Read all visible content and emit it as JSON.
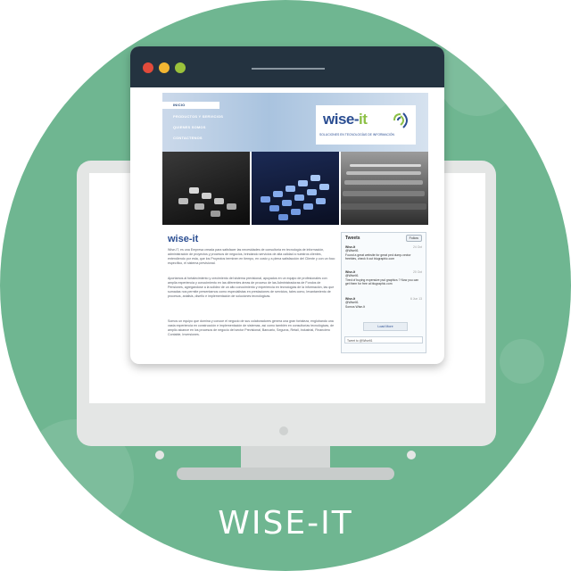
{
  "title": "WISE-IT",
  "browser": {
    "window_controls": [
      "close",
      "minimize",
      "maximize"
    ]
  },
  "site": {
    "nav": [
      "INICIO",
      "PRODUCTOS Y SERVICIOS",
      "QUIENES SOMOS",
      "CONTACTENOS"
    ],
    "logo_main": "wise-",
    "logo_accent": "it",
    "logo_tagline": "SOLUCIONES EN TECNOLOGÍAS DE INFORMACIÓN",
    "content_logo": "wise-it",
    "paragraphs": [
      "Wise-IT, es una Empresa creada para satisfacer las necesidades de consultoría en tecnología de información, administración de proyectos y procesos de negocios, brindando servicios de alta calidad a nuestros clientes, entendiendo por esta, que los Proyectos terminen en tiempo, en costo y a plena satisfacción del Cliente y con un foco específico, el sistema previsional.",
      "Aportamos al fortalecimiento y crecimiento del sistema previsional, apoyados en un equipo de profesionales con amplia experiencia y conocimiento en las diferentes áreas de proceso de las Administradoras de Fondos de Pensiones, agregándose a la solidez de un alto conocimiento y experiencia en tecnologías de la información, las que sumadas nos permite presentarnos como especialistas en prestaciones de servicios, tales como, levantamiento de procesos, análisis, diseño e implementación de soluciones tecnológicas.",
      "Somos un equipo que domina y conoce el negocio de sus colaboradores genera una gran fortaleza, englobando una vasta experiencia en construcción e implementación de sistemas, así como también en consultorías tecnológicas, de amplio alcance en los procesos de negocio del sector Previsional, Bancario, Seguros, Retail, Industrial, Financiero Contable, Inversiones."
    ],
    "tweets": {
      "header": "Tweets",
      "follow_label": "Follow",
      "items": [
        {
          "name": "Wise-It",
          "handle": "@WiseIt1",
          "date": "24 Oct",
          "text": "Found a great website for great ped dump-vector freebies, check it out blugraphic.com"
        },
        {
          "name": "Wise-It",
          "handle": "@WiseIt1",
          "date": "20 Oct",
          "text": "Tired of buying expensive psd graphics ? Now you can get them for free at blugraphic.com"
        },
        {
          "name": "Wise-It",
          "handle": "@WiseIt1",
          "date": "6 Jun 13",
          "text": "Somos Wise-It"
        }
      ],
      "load_more": "Load More",
      "compose_placeholder": "Tweet to @WiseIt1"
    }
  },
  "colors": {
    "background": "#6fb691",
    "browser_bar": "#243340",
    "brand_blue": "#2b4e92",
    "brand_green": "#8cc045"
  }
}
